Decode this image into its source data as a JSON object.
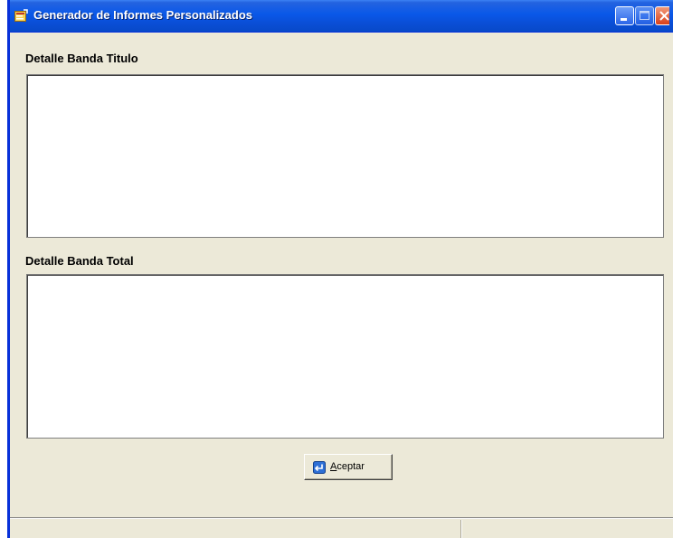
{
  "window": {
    "title": "Generador de Informes Personalizados",
    "icon": "report-generator-icon",
    "controls": [
      "minimize-icon",
      "maximize-icon",
      "close-icon"
    ]
  },
  "sections": {
    "title_band": {
      "label": "Detalle Banda Titulo",
      "value": ""
    },
    "total_band": {
      "label": "Detalle Banda Total",
      "value": ""
    }
  },
  "buttons": {
    "accept": {
      "mnemonic": "A",
      "label_rest": "ceptar",
      "icon": "enter-icon"
    }
  },
  "statusbar": {
    "pane1": "",
    "pane2": ""
  },
  "colors": {
    "titlebar": "#0a58e8",
    "window_bg": "#ece9d8",
    "close_button": "#d8401a"
  }
}
